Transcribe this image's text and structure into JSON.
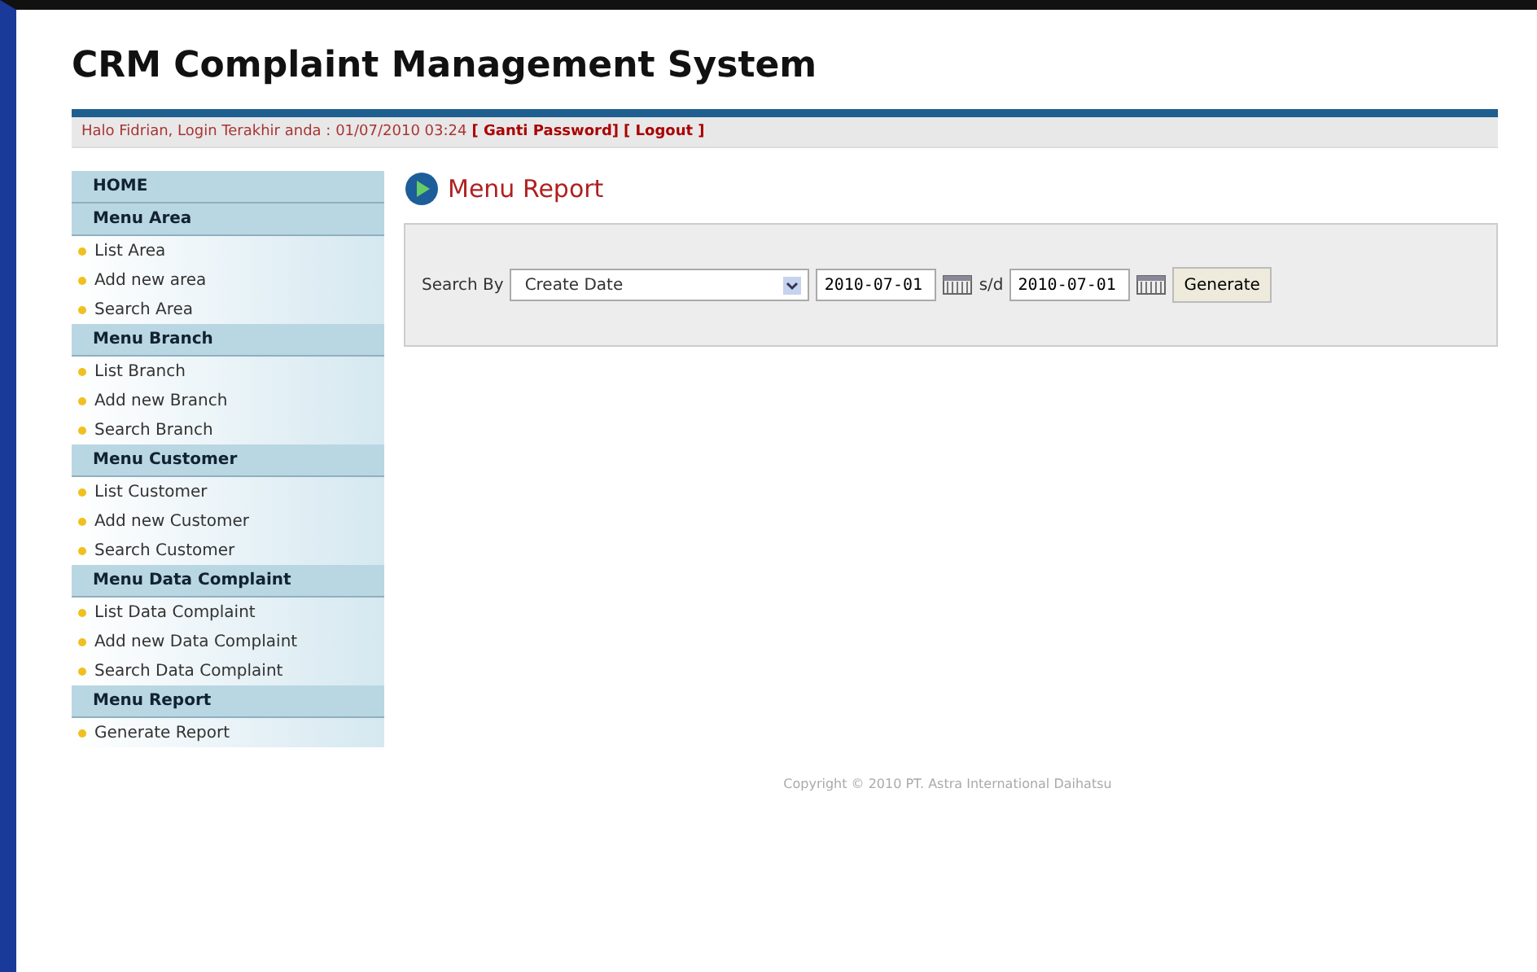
{
  "header": {
    "title": "CRM Complaint Management System"
  },
  "login_bar": {
    "text": "Halo Fidrian, Login Terakhir anda : 01/07/2010 03:24",
    "links": [
      "[ Ganti Password]",
      "[ Logout ]"
    ]
  },
  "sidebar": [
    {
      "title": "HOME"
    },
    {
      "title": "Menu Area",
      "items": [
        "List Area",
        "Add new area",
        "Search Area"
      ]
    },
    {
      "title": "Menu Branch",
      "items": [
        "List Branch",
        "Add new Branch",
        "Search Branch"
      ]
    },
    {
      "title": "Menu Customer",
      "items": [
        "List Customer",
        "Add new Customer",
        "Search Customer"
      ]
    },
    {
      "title": "Menu Data Complaint",
      "items": [
        "List Data Complaint",
        "Add new Data Complaint",
        "Search Data Complaint"
      ]
    },
    {
      "title": "Menu Report",
      "items": [
        "Generate Report"
      ]
    }
  ],
  "main": {
    "title": "Menu Report",
    "search_label": "Search By",
    "search_by": "Create Date",
    "date_from": "2010-07-01",
    "separator": "s/d",
    "date_to": "2010-07-01",
    "button": "Generate"
  },
  "footer": {
    "copyright": "Copyright © 2010 PT. Astra International Daihatsu"
  }
}
